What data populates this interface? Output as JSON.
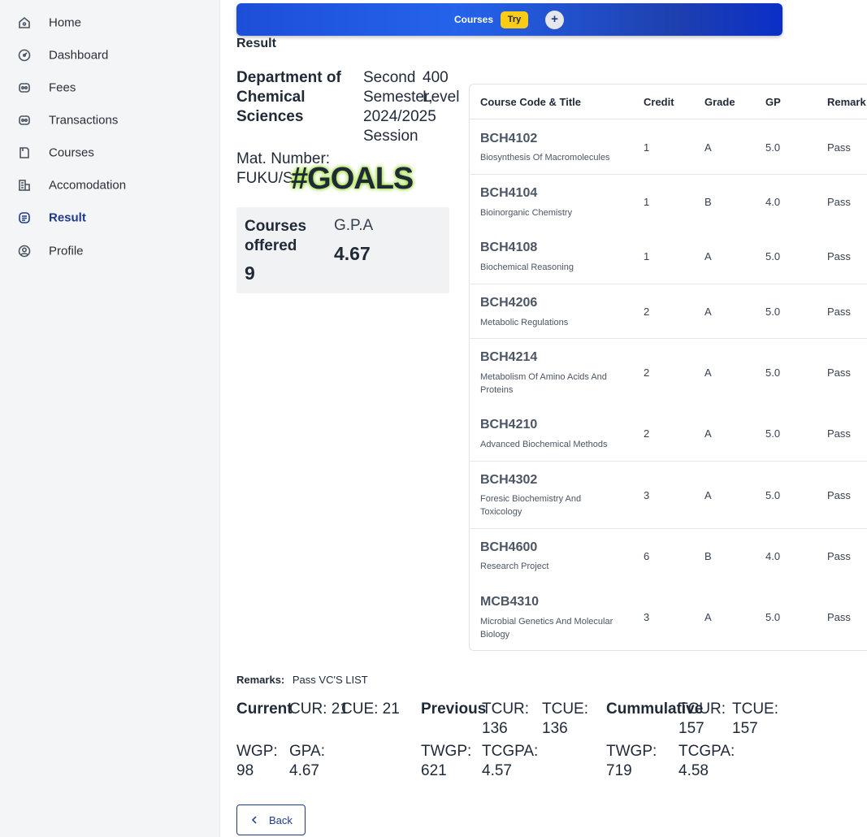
{
  "sidebar": {
    "items": [
      {
        "label": "Home",
        "icon": "home-icon"
      },
      {
        "label": "Dashboard",
        "icon": "dashboard-icon"
      },
      {
        "label": "Fees",
        "icon": "fees-icon"
      },
      {
        "label": "Transactions",
        "icon": "transactions-icon"
      },
      {
        "label": "Courses",
        "icon": "courses-icon"
      },
      {
        "label": "Accomodation",
        "icon": "building-icon"
      },
      {
        "label": "Result",
        "icon": "result-icon",
        "active": true
      },
      {
        "label": "Profile",
        "icon": "profile-icon"
      }
    ]
  },
  "banner": {
    "label": "Courses",
    "badge": "Try",
    "plus": "+"
  },
  "page": {
    "title": "Result"
  },
  "header": {
    "department": "Department of Chemical Sciences",
    "semester": "Second Semester, 2024/2025 Session",
    "level": "400 Level",
    "mat_number": "Mat. Number: FUKU/S",
    "sticker": "#GOALS"
  },
  "summary": {
    "courses_label": "Courses offered",
    "courses_value": "9",
    "gpa_label": "G.P.A",
    "gpa_value": "4.67"
  },
  "table": {
    "headers": [
      "Course Code & Title",
      "Credit",
      "Grade",
      "GP",
      "Remark"
    ],
    "rows": [
      {
        "code": "BCH4102",
        "title": "Biosynthesis Of Macromolecules",
        "credit": "1",
        "grade": "A",
        "gp": "5.0",
        "remark": "Pass"
      },
      {
        "code": "BCH4104",
        "title": "Bioinorganic Chemistry",
        "credit": "1",
        "grade": "B",
        "gp": "4.0",
        "remark": "Pass"
      },
      {
        "code": "BCH4108",
        "title": "Biochemical Reasoning",
        "credit": "1",
        "grade": "A",
        "gp": "5.0",
        "remark": "Pass"
      },
      {
        "code": "BCH4206",
        "title": "Metabolic Regulations",
        "credit": "2",
        "grade": "A",
        "gp": "5.0",
        "remark": "Pass"
      },
      {
        "code": "BCH4214",
        "title": "Metabolism Of Amino Acids And Proteins",
        "credit": "2",
        "grade": "A",
        "gp": "5.0",
        "remark": "Pass"
      },
      {
        "code": "BCH4210",
        "title": "Advanced Biochemical Methods",
        "credit": "2",
        "grade": "A",
        "gp": "5.0",
        "remark": "Pass"
      },
      {
        "code": "BCH4302",
        "title": "Foresic Biochemistry And Toxicology",
        "credit": "3",
        "grade": "A",
        "gp": "5.0",
        "remark": "Pass"
      },
      {
        "code": "BCH4600",
        "title": "Research Project",
        "credit": "6",
        "grade": "B",
        "gp": "4.0",
        "remark": "Pass"
      },
      {
        "code": "MCB4310",
        "title": "Microbial Genetics And Molecular Biology",
        "credit": "3",
        "grade": "A",
        "gp": "5.0",
        "remark": "Pass"
      }
    ]
  },
  "remarks": {
    "label": "Remarks:",
    "value": "Pass VC'S LIST"
  },
  "stats": {
    "current": {
      "title": "Current",
      "cur": "CUR: 21",
      "cue": "CUE: 21",
      "wgp": "WGP: 98",
      "gpa": "GPA: 4.67"
    },
    "previous": {
      "title": "Previous",
      "tcur": "TCUR: 136",
      "tcue": "TCUE: 136",
      "twgp": "TWGP: 621",
      "tcgpa": "TCGPA: 4.57"
    },
    "cummulative": {
      "title": "Cummulative",
      "tcur": "TCUR: 157",
      "tcue": "TCUE: 157",
      "twgp": "TWGP: 719",
      "tcgpa": "TCGPA: 4.58"
    }
  },
  "back_button": {
    "label": "Back"
  },
  "colors": {
    "accent": "#1e3a8a",
    "banner": "#2563eb",
    "badge": "#facc15",
    "sidebar_bg": "#f4f5f7"
  }
}
